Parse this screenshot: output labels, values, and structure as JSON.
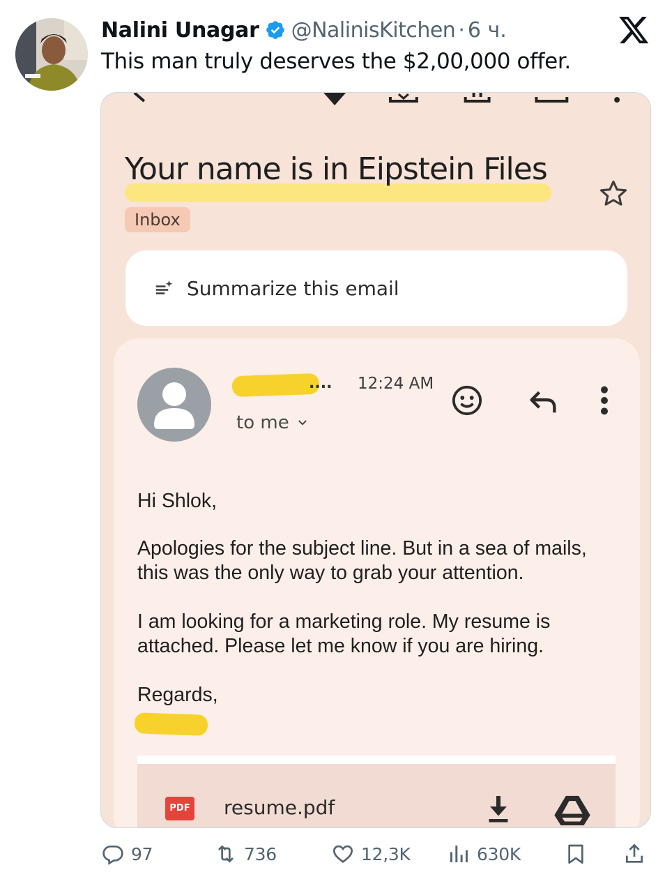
{
  "tweet": {
    "author_name": "Nalini Unagar",
    "handle": "@NalinisKitchen",
    "separator": "·",
    "time": "6 ч.",
    "text": "This man truly deserves the $2,00,000 offer.",
    "verified": true
  },
  "email": {
    "subject": "Your name is in Eipstein Files",
    "label": "Inbox",
    "summarize_label": "Summarize this email",
    "sender_ellipsis": "....",
    "time": "12:24 AM",
    "recipient": "to me",
    "greeting": "Hi Shlok,",
    "paragraph1": [
      "Apologies for the subject line. But in a sea of mails,",
      "this was the only way to grab your attention."
    ],
    "paragraph2": [
      "I am looking for a marketing role. My resume is",
      "attached. Please let me know if you are hiring."
    ],
    "closing": "Regards,",
    "attachment": {
      "badge": "PDF",
      "file_name": "resume.pdf"
    }
  },
  "engagement": {
    "replies": "97",
    "reposts": "736",
    "likes": "12,3K",
    "views": "630K"
  },
  "colors": {
    "verified_blue": "#1d9bf0",
    "highlight_yellow": "#fbe67a",
    "redaction_yellow": "#f7d22d",
    "email_bg": "#f8e3d8",
    "pdf_red": "#e5443b"
  },
  "icons": [
    "verified-badge-icon",
    "x-logo-icon",
    "star-icon",
    "summarize-sparkle-icon",
    "person-avatar-icon",
    "chevron-down-icon",
    "emoji-icon",
    "reply-icon",
    "more-vertical-icon",
    "download-icon",
    "google-drive-icon",
    "reply-bubble-icon",
    "repost-icon",
    "heart-icon",
    "views-bar-icon",
    "bookmark-icon",
    "share-icon"
  ]
}
